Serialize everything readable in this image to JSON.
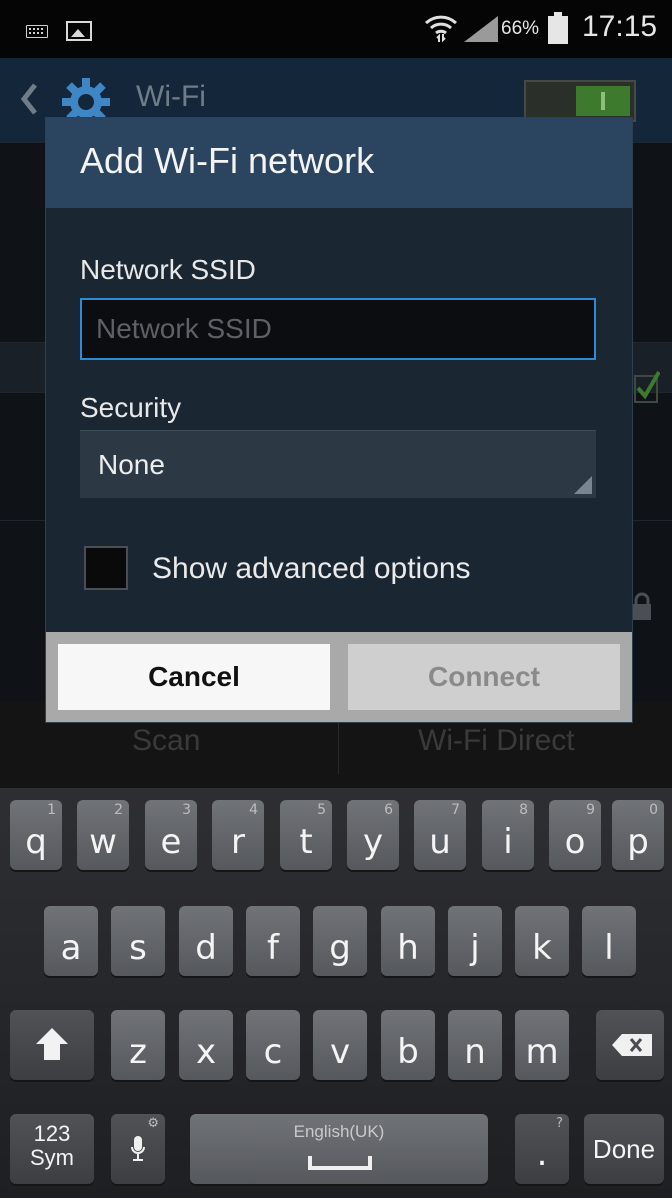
{
  "status_bar": {
    "battery_percent": "66%",
    "time": "17:15",
    "icons": [
      "keyboard-icon",
      "image-icon",
      "wifi-icon",
      "signal-icon",
      "battery-icon"
    ]
  },
  "background": {
    "app_title": "Wi-Fi",
    "wifi_toggle_on": true,
    "bottom_buttons": {
      "scan": "Scan",
      "wifi_direct": "Wi-Fi Direct"
    }
  },
  "dialog": {
    "title": "Add Wi-Fi network",
    "ssid_label": "Network SSID",
    "ssid_placeholder": "Network SSID",
    "ssid_value": "",
    "security_label": "Security",
    "security_value": "None",
    "advanced_label": "Show advanced options",
    "advanced_checked": false,
    "cancel_label": "Cancel",
    "connect_label": "Connect"
  },
  "keyboard": {
    "row1": [
      {
        "ch": "q",
        "num": "1"
      },
      {
        "ch": "w",
        "num": "2"
      },
      {
        "ch": "e",
        "num": "3"
      },
      {
        "ch": "r",
        "num": "4"
      },
      {
        "ch": "t",
        "num": "5"
      },
      {
        "ch": "y",
        "num": "6"
      },
      {
        "ch": "u",
        "num": "7"
      },
      {
        "ch": "i",
        "num": "8"
      },
      {
        "ch": "o",
        "num": "9"
      },
      {
        "ch": "p",
        "num": "0"
      }
    ],
    "row2": [
      "a",
      "s",
      "d",
      "f",
      "g",
      "h",
      "j",
      "k",
      "l"
    ],
    "row3": [
      "z",
      "x",
      "c",
      "v",
      "b",
      "n",
      "m"
    ],
    "sym_label_1": "123",
    "sym_label_2": "Sym",
    "language": "English(UK)",
    "dot": ".",
    "dot_hint": "?",
    "done": "Done"
  },
  "colors": {
    "accent_blue": "#2d8bd4",
    "dialog_header": "#2b4460",
    "toggle_green": "#3d7a2e"
  }
}
